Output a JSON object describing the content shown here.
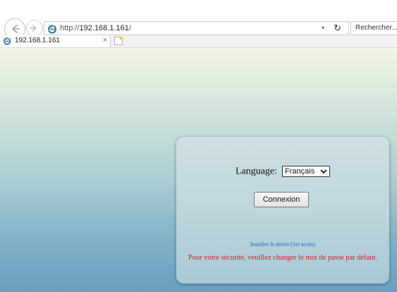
{
  "browser": {
    "url_prefix": "http://",
    "url_host": "192.168.1.161",
    "url_suffix": "/",
    "search_placeholder": "Rechercher...",
    "tab_title": "192.168.1.161",
    "refresh_glyph": "↻",
    "dropdown_glyph": "▾",
    "close_glyph": "×"
  },
  "login": {
    "language_label": "Language:",
    "language_selected": "Français",
    "connect_button": "Connexion",
    "driver_link": "Installer le driver (1er accès)",
    "security_warning": "Pour votre sécurité, veuillez changer le mot de passe par défaut."
  },
  "colors": {
    "link": "#1a5fd8",
    "warning": "#e0141e"
  }
}
